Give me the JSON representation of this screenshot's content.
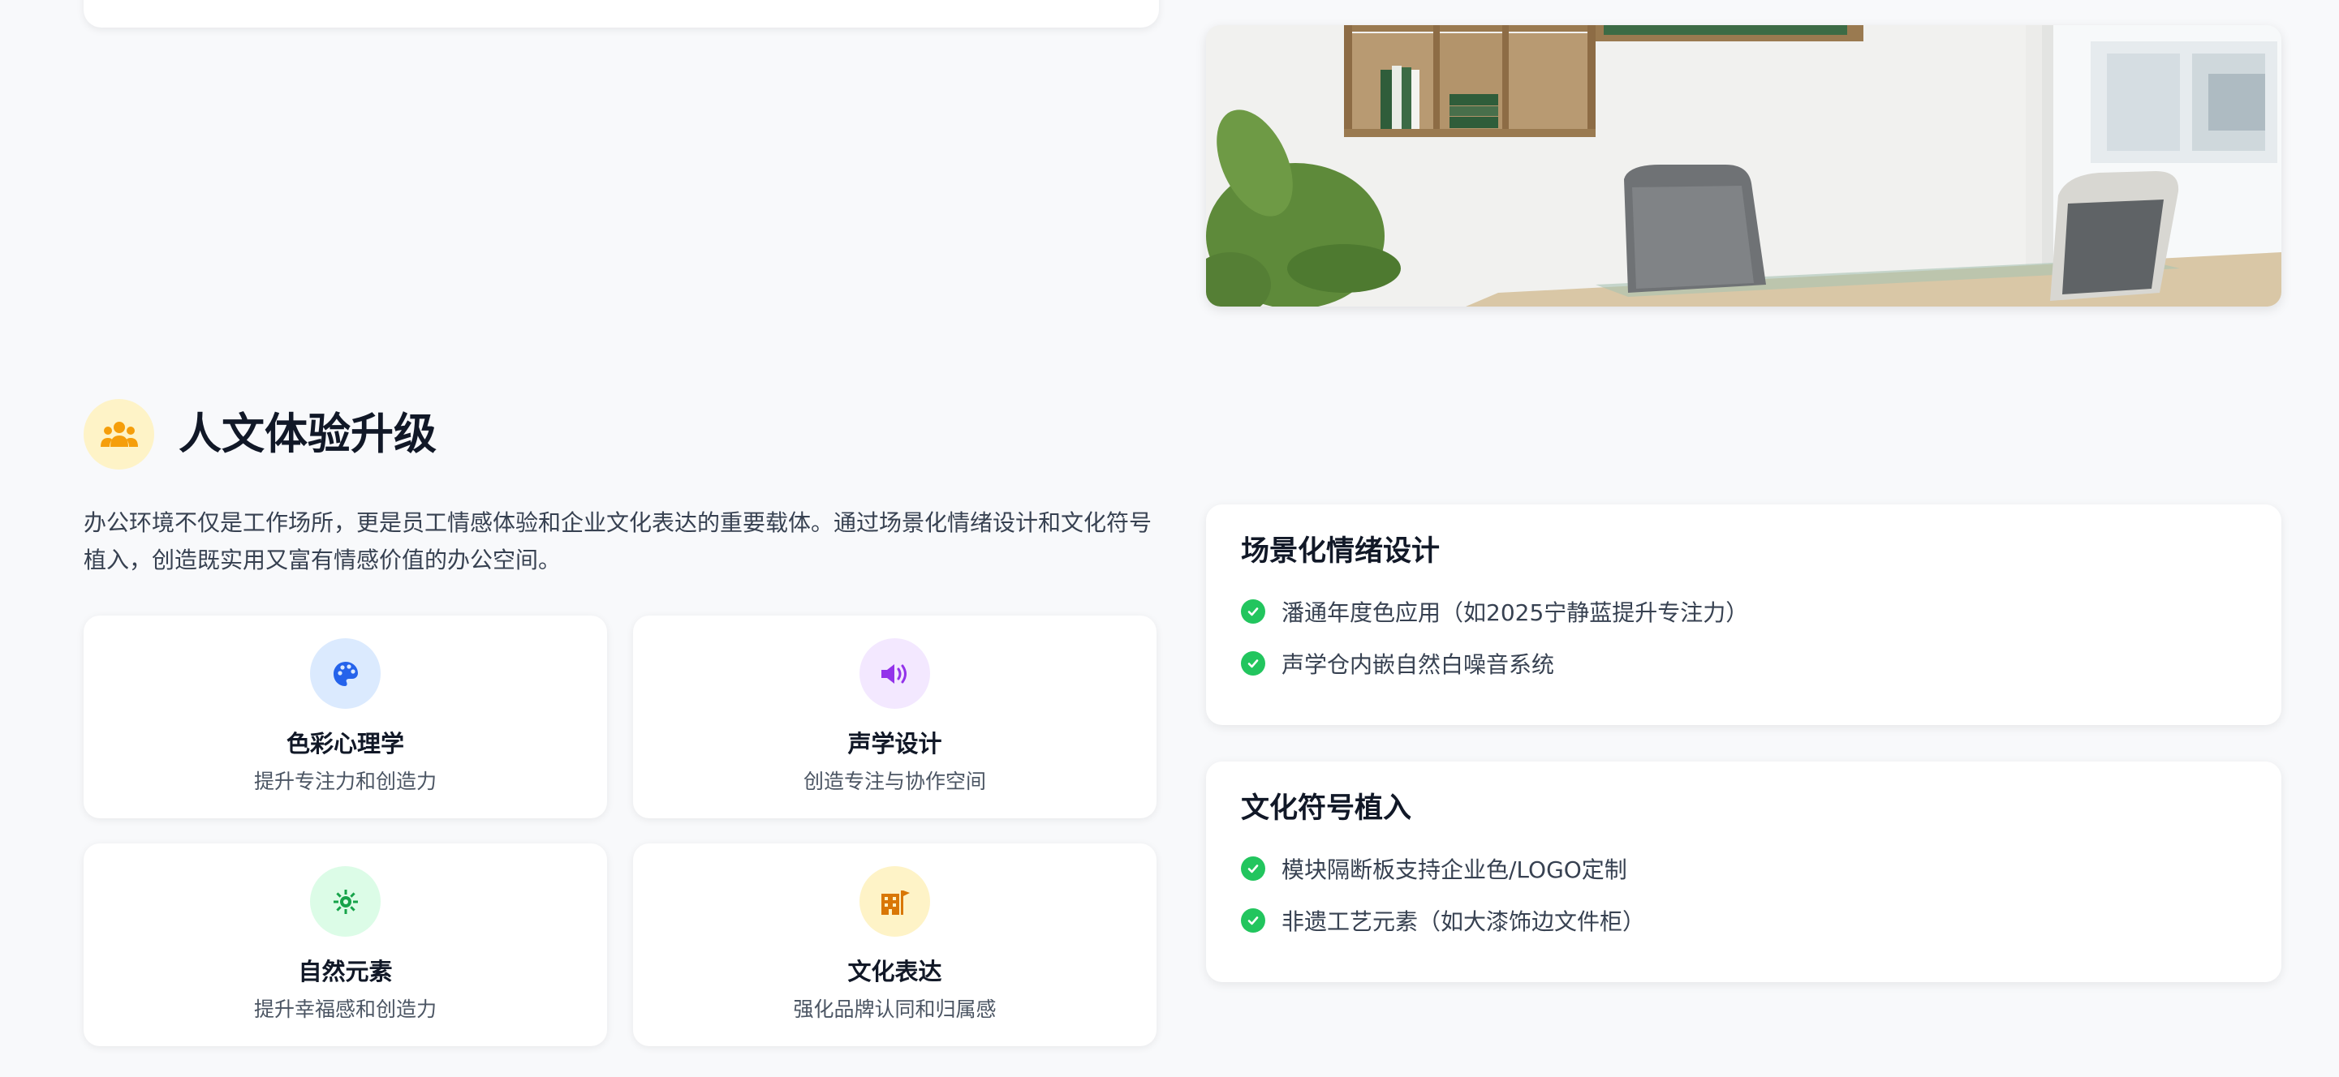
{
  "section": {
    "icon": "users-icon",
    "title": "人文体验升级",
    "intro": "办公环境不仅是工作场所，更是员工情感体验和企业文化表达的重要载体。通过场景化情绪设计和文化符号植入，创造既实用又富有情感价值的办公空间。"
  },
  "photo": {
    "subject": "office-room-photo"
  },
  "features": [
    {
      "icon": "palette-icon",
      "title": "色彩心理学",
      "subtitle": "提升专注力和创造力",
      "icon_bg": "#dbeafe",
      "icon_color": "#2563eb"
    },
    {
      "icon": "speaker-icon",
      "title": "声学设计",
      "subtitle": "创造专注与协作空间",
      "icon_bg": "#f3e8ff",
      "icon_color": "#9333ea"
    },
    {
      "icon": "sun-leaf-icon",
      "title": "自然元素",
      "subtitle": "提升幸福感和创造力",
      "icon_bg": "#dcfce7",
      "icon_color": "#16a34a"
    },
    {
      "icon": "building-icon",
      "title": "文化表达",
      "subtitle": "强化品牌认同和归属感",
      "icon_bg": "#fef3c7",
      "icon_color": "#d97706"
    }
  ],
  "panels": [
    {
      "title": "场景化情绪设计",
      "items": [
        "潘通年度色应用（如2025宁静蓝提升专注力）",
        "声学仓内嵌自然白噪音系统"
      ]
    },
    {
      "title": "文化符号植入",
      "items": [
        "模块隔断板支持企业色/LOGO定制",
        "非遗工艺元素（如大漆饰边文件柜）"
      ]
    }
  ],
  "colors": {
    "check": "#22c55e",
    "section_icon_bg": "#fef3c7",
    "section_icon": "#f59e0b"
  }
}
